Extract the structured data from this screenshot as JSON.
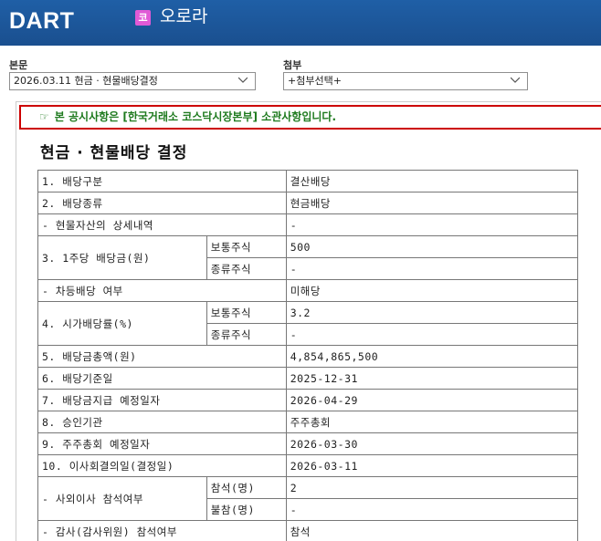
{
  "header": {
    "logo_text": "DART",
    "corp_badge": "코",
    "corp_name": "오로라"
  },
  "selectors": {
    "body_label": "본문",
    "body_value": "2026.03.11  현금 · 현물배당결정",
    "attach_label": "첨부",
    "attach_value": "+첨부선택+"
  },
  "notice": {
    "icon": "pointing-hand-icon",
    "text": "본 공시사항은 [한국거래소 코스닥시장본부] 소관사항입니다."
  },
  "doc": {
    "title": "현금 · 현물배당 결정",
    "rows": {
      "r1": {
        "label": "1. 배당구분",
        "value": "결산배당"
      },
      "r2": {
        "label": "2. 배당종류",
        "value": "현금배당"
      },
      "r3": {
        "label": "- 현물자산의 상세내역",
        "value": "-"
      },
      "r4": {
        "label": "3. 1주당 배당금(원)",
        "sub1": "보통주식",
        "val1": "500",
        "sub2": "종류주식",
        "val2": "-"
      },
      "r5": {
        "label": "- 차등배당 여부",
        "value": "미해당"
      },
      "r6": {
        "label": "4. 시가배당률(%)",
        "sub1": "보통주식",
        "val1": "3.2",
        "sub2": "종류주식",
        "val2": "-"
      },
      "r7": {
        "label": "5. 배당금총액(원)",
        "value": "4,854,865,500"
      },
      "r8": {
        "label": "6. 배당기준일",
        "value": "2025-12-31"
      },
      "r9": {
        "label": "7. 배당금지급 예정일자",
        "value": "2026-04-29"
      },
      "r10": {
        "label": "8. 승인기관",
        "value": "주주총회"
      },
      "r11": {
        "label": "9. 주주총회 예정일자",
        "value": "2026-03-30"
      },
      "r12": {
        "label": "10. 이사회결의일(결정일)",
        "value": "2026-03-11"
      },
      "r13": {
        "label": "- 사외이사 참석여부",
        "sub1": "참석(명)",
        "val1": "2",
        "sub2": "불참(명)",
        "val2": "-"
      },
      "r14": {
        "label": "- 감사(감사위원) 참석여부",
        "value": "참석"
      }
    }
  }
}
